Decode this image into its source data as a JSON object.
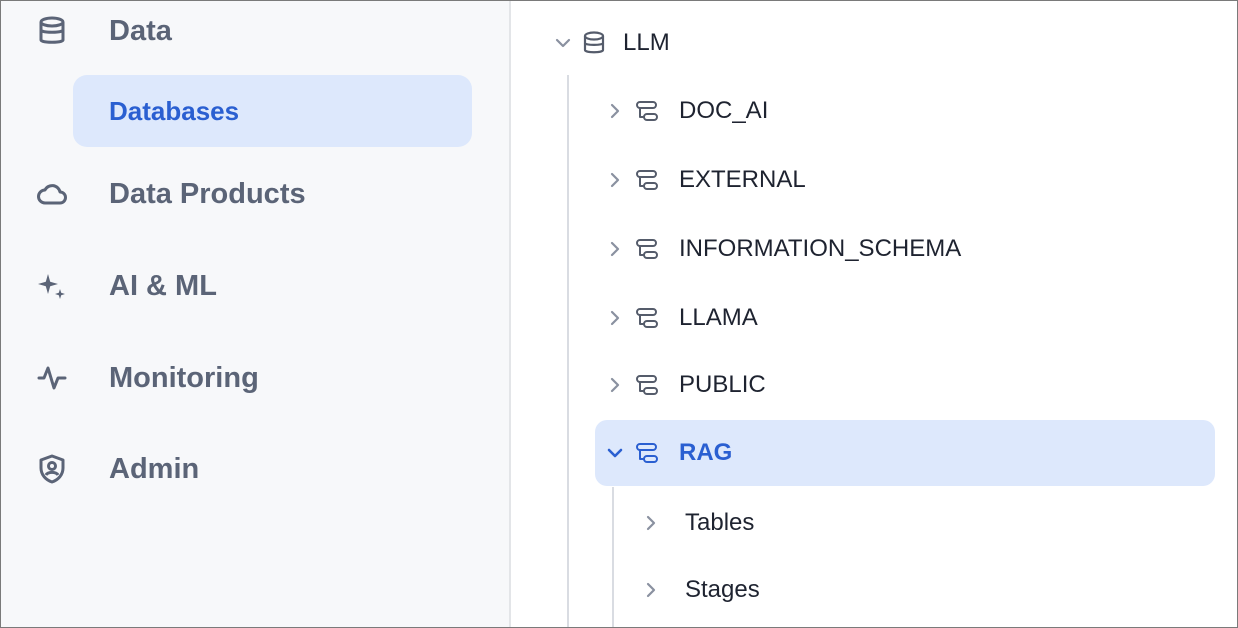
{
  "sidebar": {
    "items": [
      {
        "label": "Data",
        "icon": "database-icon"
      },
      {
        "label": "Data Products",
        "icon": "cloud-icon"
      },
      {
        "label": "AI & ML",
        "icon": "sparkles-icon"
      },
      {
        "label": "Monitoring",
        "icon": "activity-icon"
      },
      {
        "label": "Admin",
        "icon": "shield-user-icon"
      }
    ],
    "selected_sub": {
      "label": "Databases"
    }
  },
  "tree": {
    "root": {
      "label": "LLM",
      "icon": "database-icon",
      "expanded": true
    },
    "schemas": [
      {
        "label": "DOC_AI",
        "expanded": false
      },
      {
        "label": "EXTERNAL",
        "expanded": false
      },
      {
        "label": "INFORMATION_SCHEMA",
        "expanded": false
      },
      {
        "label": "LLAMA",
        "expanded": false
      },
      {
        "label": "PUBLIC",
        "expanded": false
      },
      {
        "label": "RAG",
        "expanded": true,
        "selected": true
      }
    ],
    "rag_children": [
      {
        "label": "Tables"
      },
      {
        "label": "Stages"
      }
    ]
  },
  "colors": {
    "accent": "#2a5fd1",
    "selected_bg": "#dde8fc",
    "sidebar_bg": "#f7f8fa",
    "muted_text": "#5b6477"
  }
}
